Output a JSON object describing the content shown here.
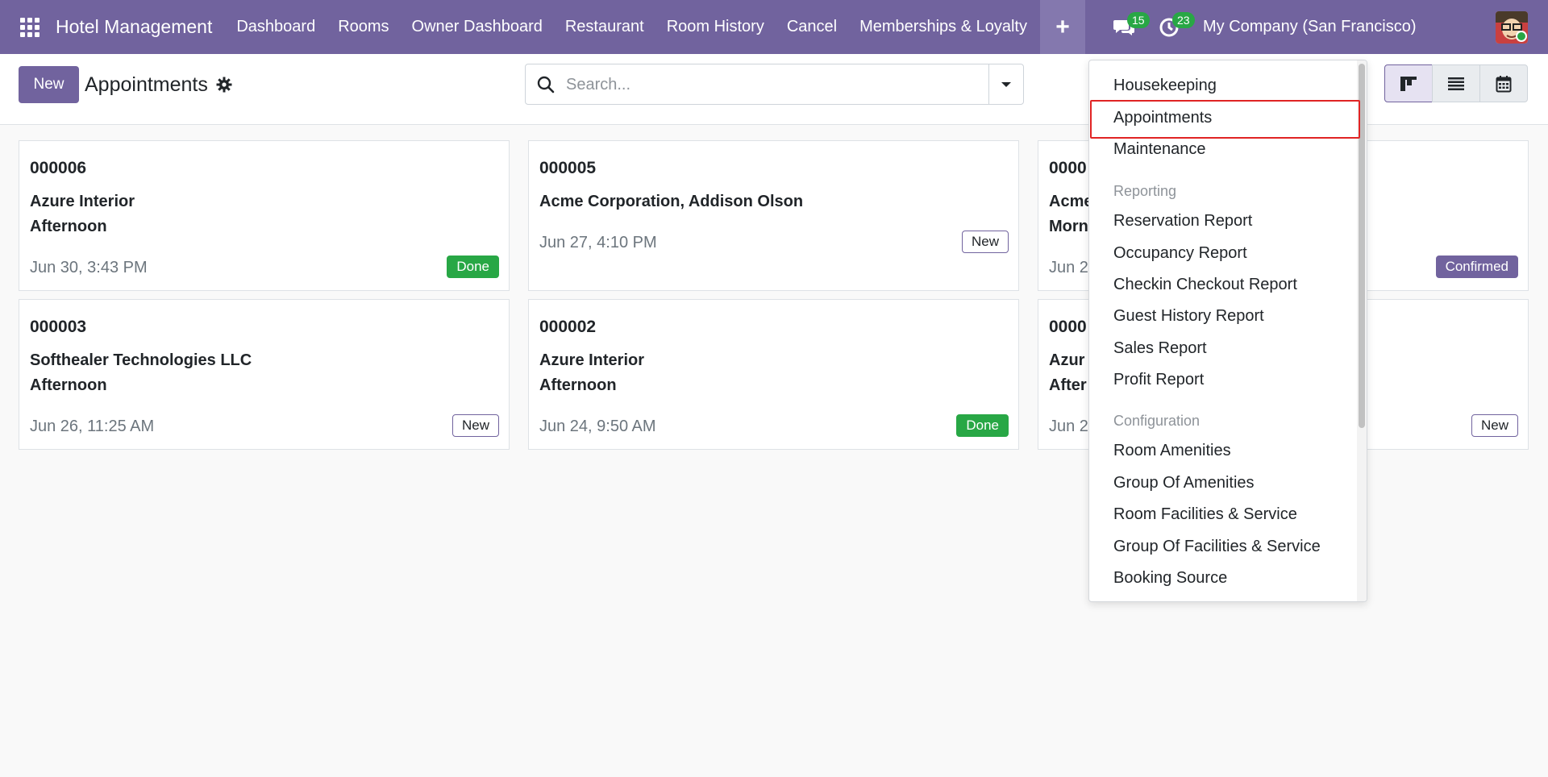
{
  "navbar": {
    "brand": "Hotel Management",
    "menu": [
      "Dashboard",
      "Rooms",
      "Owner Dashboard",
      "Restaurant",
      "Room History",
      "Cancel",
      "Memberships & Loyalty"
    ],
    "plus_label": "+",
    "messages_count": "15",
    "activities_count": "23",
    "company": "My Company (San Francisco)"
  },
  "control": {
    "new_label": "New",
    "title": "Appointments",
    "search_placeholder": "Search..."
  },
  "cards": [
    {
      "ref": "000006",
      "partner_line1": "Azure Interior",
      "partner_line2": "Afternoon",
      "date": "Jun 30, 3:43 PM",
      "status": "Done"
    },
    {
      "ref": "000005",
      "partner_line1": "Acme Corporation, Addison Olson",
      "partner_line2": "",
      "date": "Jun 27, 4:10 PM",
      "status": "New"
    },
    {
      "ref": "0000",
      "partner_line1": "Acme",
      "partner_line2": "Morn",
      "date": "Jun 2",
      "status": "Confirmed"
    },
    {
      "ref": "000003",
      "partner_line1": "Softhealer Technologies LLC",
      "partner_line2": "Afternoon",
      "date": "Jun 26, 11:25 AM",
      "status": "New"
    },
    {
      "ref": "000002",
      "partner_line1": "Azure Interior",
      "partner_line2": "Afternoon",
      "date": "Jun 24, 9:50 AM",
      "status": "Done"
    },
    {
      "ref": "0000",
      "partner_line1": "Azur",
      "partner_line2": "After",
      "date": "Jun 2",
      "status": "New"
    }
  ],
  "dropdown": {
    "items_top": [
      "Housekeeping",
      "Appointments",
      "Maintenance"
    ],
    "reporting_header": "Reporting",
    "reporting_items": [
      "Reservation Report",
      "Occupancy Report",
      "Checkin Checkout Report",
      "Guest History Report",
      "Sales Report",
      "Profit Report"
    ],
    "configuration_header": "Configuration",
    "configuration_items": [
      "Room Amenities",
      "Group Of Amenities",
      "Room Facilities & Service",
      "Group Of Facilities & Service",
      "Booking Source"
    ]
  },
  "colors": {
    "brand": "#71639e",
    "success": "#28a745",
    "highlight": "#e02424"
  }
}
